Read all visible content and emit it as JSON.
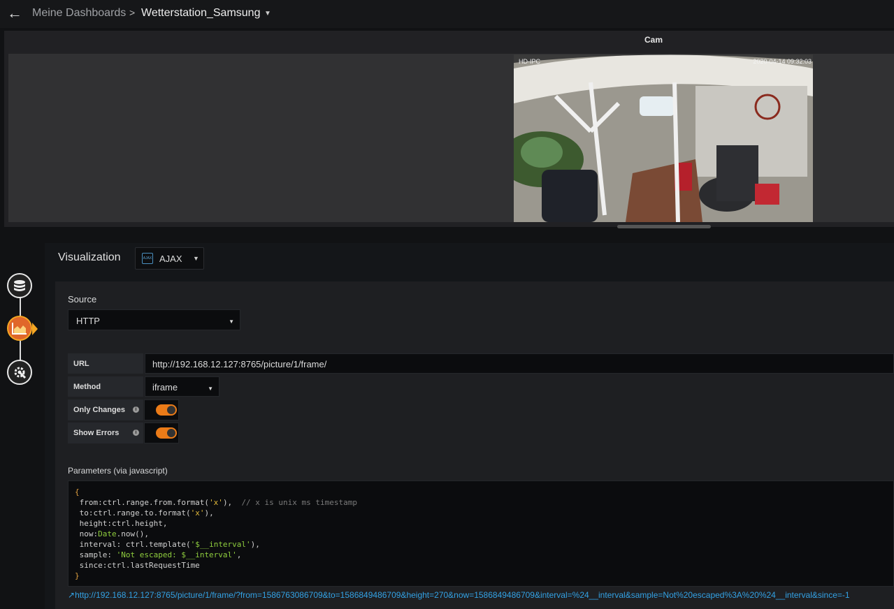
{
  "header": {
    "back_icon": "arrow-left-icon",
    "breadcrumb_parent": "Meine Dashboards",
    "breadcrumb_separator": ">",
    "dashboard_title": "Wetterstation_Samsung"
  },
  "panel": {
    "title": "Cam",
    "camera": {
      "label": "HD-IPC",
      "timestamp": "2020-04-14  09:32:03"
    }
  },
  "editor": {
    "rail": [
      {
        "icon": "database-icon"
      },
      {
        "icon": "area-chart-icon",
        "active": true
      },
      {
        "icon": "gear-wrench-icon"
      }
    ],
    "visualization_label": "Visualization",
    "visualization_value": "AJAX",
    "visualization_icon_text": "AJAX",
    "source_label": "Source",
    "source_value": "HTTP",
    "url_label": "URL",
    "url_value": "http://192.168.12.127:8765/picture/1/frame/",
    "method_label": "Method",
    "method_value": "iframe",
    "only_changes_label": "Only Changes",
    "only_changes_on": true,
    "show_errors_label": "Show Errors",
    "show_errors_on": true,
    "params_label": "Parameters (via javascript)",
    "code": {
      "l0": "{",
      "l1a": " from:ctrl.range.from.format(",
      "l1s": "'x'",
      "l1b": "),  ",
      "l1c": "// x is unix ms timestamp",
      "l2a": " to:ctrl.range.to.format(",
      "l2s": "'x'",
      "l2b": "),",
      "l3": " height:ctrl.height,",
      "l4a": " now:",
      "l4g": "Date",
      "l4b": ".now(),",
      "l5a": " interval: ctrl.template(",
      "l5s": "'$__interval'",
      "l5b": "),",
      "l6a": " sample: ",
      "l6s": "'Not escaped: $__interval'",
      "l6b": ",",
      "l7": " since:ctrl.lastRequestTime",
      "l8": "}"
    },
    "preview_link": "http://192.168.12.127:8765/picture/1/frame/?from=1586763086709&to=1586849486709&height=270&now=1586849486709&interval=%24__interval&sample=Not%20escaped%3A%20%24__interval&since=-1",
    "accent_color": "#eb7b18"
  }
}
